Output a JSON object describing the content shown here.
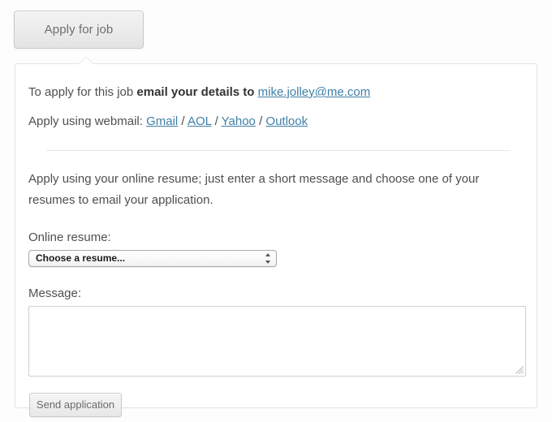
{
  "toggle": {
    "label": "Apply for job"
  },
  "panel": {
    "email_line": {
      "prefix": "To apply for this job ",
      "bold": "email your details to",
      "space": " ",
      "email": "mike.jolley@me.com"
    },
    "webmail_line": {
      "label": "Apply using webmail:",
      "sep": " / ",
      "providers": [
        {
          "label": "Gmail"
        },
        {
          "label": "AOL"
        },
        {
          "label": "Yahoo"
        },
        {
          "label": "Outlook"
        }
      ]
    },
    "intro": "Apply using your online resume; just enter a short message and choose one of your resumes to email your application.",
    "resume": {
      "label": "Online resume:",
      "selected": "Choose a resume...",
      "options": [
        "Choose a resume..."
      ]
    },
    "message": {
      "label": "Message:",
      "value": "",
      "placeholder": ""
    },
    "submit": {
      "label": "Send application"
    }
  },
  "colors": {
    "link": "#3f7fa6",
    "text": "#4f4f4f",
    "panel_border": "#e4e4e4",
    "page_bg": "#fdfdfd"
  },
  "icons": {
    "select_stepper": "stepper-arrows-icon",
    "resize_grip": "resize-grip-icon",
    "caret": "popover-caret-icon"
  }
}
